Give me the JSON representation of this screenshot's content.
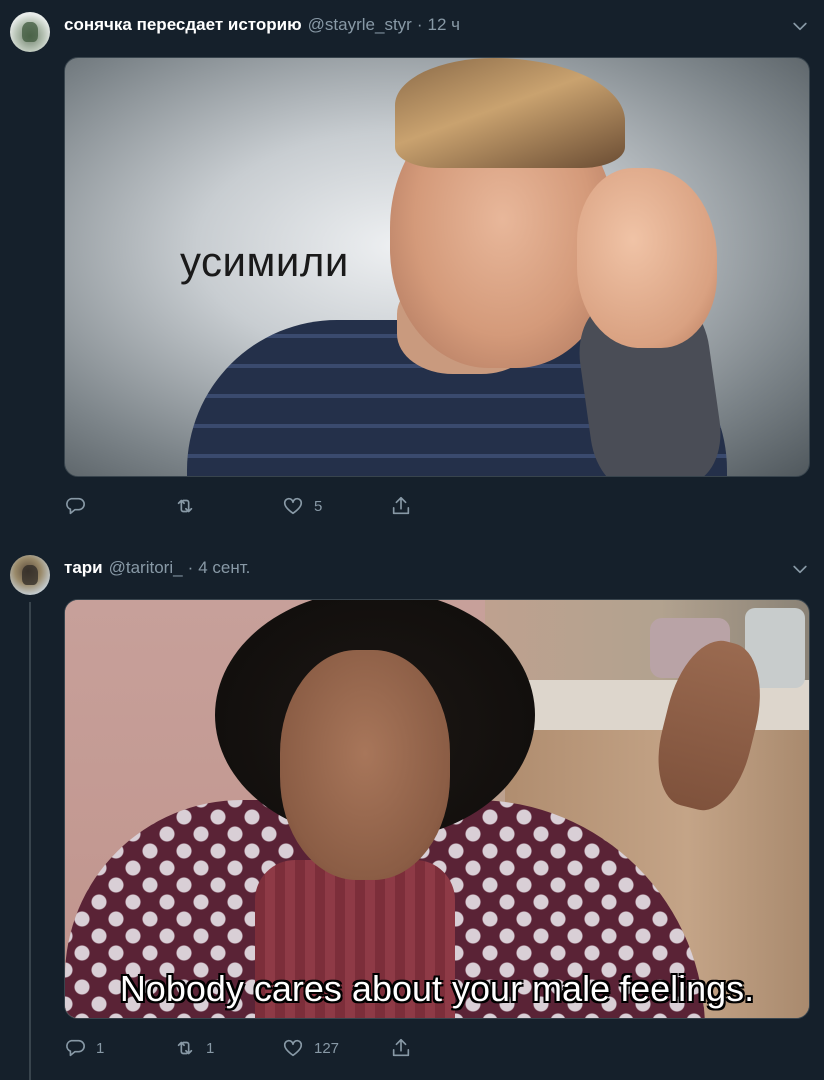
{
  "tweets": [
    {
      "author_name": "сонячка пересдает историю",
      "handle": "@stayrle_styr",
      "separator": "·",
      "time": "12 ч",
      "media_caption": "усимили",
      "actions": {
        "reply_count": "",
        "retweet_count": "",
        "like_count": "5"
      }
    },
    {
      "author_name": "тари",
      "handle": "@taritori_",
      "separator": "·",
      "time": "4 сент.",
      "media_caption": "Nobody cares about your  male feelings.",
      "actions": {
        "reply_count": "1",
        "retweet_count": "1",
        "like_count": "127"
      }
    }
  ],
  "icons": [
    "chevron-down-icon",
    "reply-icon",
    "retweet-icon",
    "like-icon",
    "share-icon"
  ],
  "colors": {
    "background": "#15202b",
    "secondary_text": "#8899a6",
    "border": "#38444d"
  }
}
